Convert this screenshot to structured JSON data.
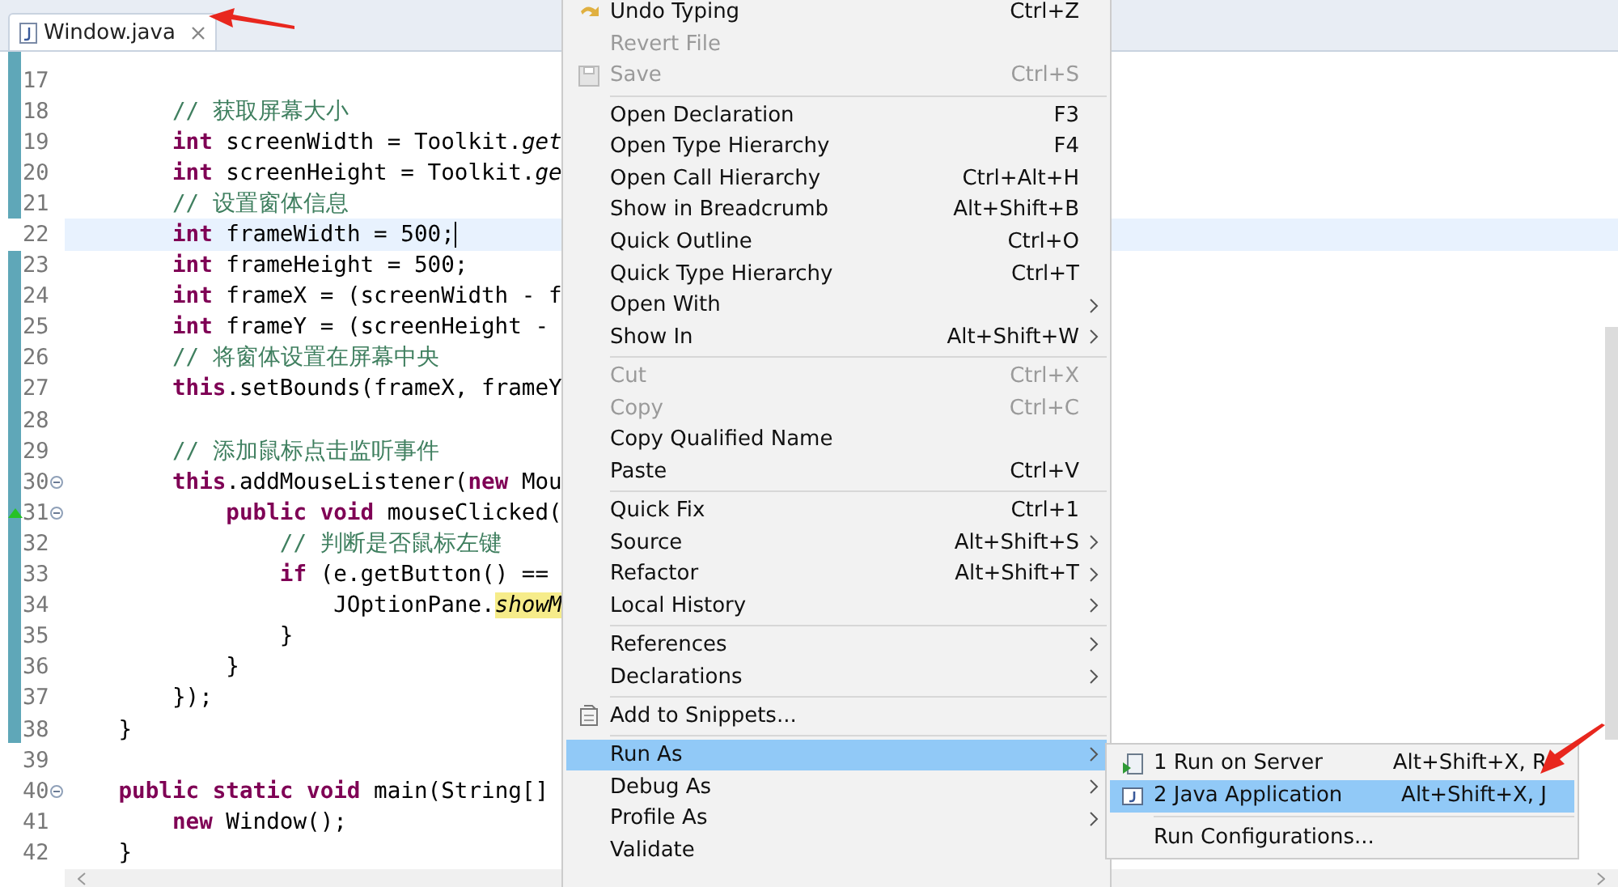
{
  "editor_tab": {
    "title": "Window.java",
    "selected": true
  },
  "code_lines": [
    {
      "number": "17",
      "fold": false,
      "override": false,
      "current": false
    },
    {
      "number": "18",
      "fold": false,
      "override": false,
      "current": false,
      "segments": [
        {
          "kind": "comment",
          "text": "        // 获取屏幕大小"
        }
      ]
    },
    {
      "number": "19",
      "fold": false,
      "override": false,
      "current": false,
      "segments": [
        {
          "kind": "keyword",
          "text": "        int"
        },
        {
          "kind": "plain",
          "text": " screenWidth = Toolkit."
        },
        {
          "kind": "static",
          "text": "get"
        }
      ]
    },
    {
      "number": "20",
      "fold": false,
      "override": false,
      "current": false,
      "segments": [
        {
          "kind": "keyword",
          "text": "        int"
        },
        {
          "kind": "plain",
          "text": " screenHeight = Toolkit."
        },
        {
          "kind": "static",
          "text": "ge"
        }
      ]
    },
    {
      "number": "21",
      "fold": false,
      "override": false,
      "current": false,
      "segments": [
        {
          "kind": "comment",
          "text": "        // 设置窗体信息"
        }
      ]
    },
    {
      "number": "22",
      "fold": false,
      "override": false,
      "current": true,
      "segments": [
        {
          "kind": "keyword",
          "text": "        int"
        },
        {
          "kind": "plain",
          "text": " frameWidth = 500;"
        }
      ]
    },
    {
      "number": "23",
      "fold": false,
      "override": false,
      "current": false,
      "segments": [
        {
          "kind": "keyword",
          "text": "        int"
        },
        {
          "kind": "plain",
          "text": " frameHeight = 500;"
        }
      ]
    },
    {
      "number": "24",
      "fold": false,
      "override": false,
      "current": false,
      "segments": [
        {
          "kind": "keyword",
          "text": "        int"
        },
        {
          "kind": "plain",
          "text": " frameX = (screenWidth - f"
        }
      ]
    },
    {
      "number": "25",
      "fold": false,
      "override": false,
      "current": false,
      "segments": [
        {
          "kind": "keyword",
          "text": "        int"
        },
        {
          "kind": "plain",
          "text": " frameY = (screenHeight -"
        }
      ]
    },
    {
      "number": "26",
      "fold": false,
      "override": false,
      "current": false,
      "segments": [
        {
          "kind": "comment",
          "text": "        // 将窗体设置在屏幕中央"
        }
      ]
    },
    {
      "number": "27",
      "fold": false,
      "override": false,
      "current": false,
      "segments": [
        {
          "kind": "keyword",
          "text": "        this"
        },
        {
          "kind": "plain",
          "text": ".setBounds(frameX, frameY"
        }
      ]
    },
    {
      "number": "28",
      "fold": false,
      "override": false,
      "current": false
    },
    {
      "number": "29",
      "fold": false,
      "override": false,
      "current": false,
      "segments": [
        {
          "kind": "comment",
          "text": "        // 添加鼠标点击监听事件"
        }
      ]
    },
    {
      "number": "30",
      "fold": true,
      "override": false,
      "current": false,
      "segments": [
        {
          "kind": "keyword",
          "text": "        this"
        },
        {
          "kind": "plain",
          "text": ".addMouseListener("
        },
        {
          "kind": "keyword",
          "text": "new"
        },
        {
          "kind": "plain",
          "text": " Mou"
        }
      ]
    },
    {
      "number": "31",
      "fold": true,
      "override": true,
      "current": false,
      "segments": [
        {
          "kind": "keyword",
          "text": "            public void"
        },
        {
          "kind": "plain",
          "text": " mouseClicked("
        }
      ]
    },
    {
      "number": "32",
      "fold": false,
      "override": false,
      "current": false,
      "segments": [
        {
          "kind": "comment",
          "text": "                // 判断是否鼠标左键"
        }
      ]
    },
    {
      "number": "33",
      "fold": false,
      "override": false,
      "current": false,
      "segments": [
        {
          "kind": "keyword",
          "text": "                if"
        },
        {
          "kind": "plain",
          "text": " (e.getButton() =="
        }
      ]
    },
    {
      "number": "34",
      "fold": false,
      "override": false,
      "current": false,
      "segments": [
        {
          "kind": "plain",
          "text": "                    JOptionPane."
        },
        {
          "kind": "occurrence",
          "text": "showM"
        }
      ]
    },
    {
      "number": "35",
      "fold": false,
      "override": false,
      "current": false,
      "segments": [
        {
          "kind": "plain",
          "text": "                }"
        }
      ]
    },
    {
      "number": "36",
      "fold": false,
      "override": false,
      "current": false,
      "segments": [
        {
          "kind": "plain",
          "text": "            }"
        }
      ]
    },
    {
      "number": "37",
      "fold": false,
      "override": false,
      "current": false,
      "segments": [
        {
          "kind": "plain",
          "text": "        });"
        }
      ]
    },
    {
      "number": "38",
      "fold": false,
      "override": false,
      "current": false,
      "segments": [
        {
          "kind": "plain",
          "text": "    }"
        }
      ]
    },
    {
      "number": "39",
      "fold": false,
      "override": false,
      "current": false
    },
    {
      "number": "40",
      "fold": true,
      "override": false,
      "current": false,
      "segments": [
        {
          "kind": "keyword",
          "text": "    public static void"
        },
        {
          "kind": "plain",
          "text": " main(String[]"
        }
      ]
    },
    {
      "number": "41",
      "fold": false,
      "override": false,
      "current": false,
      "segments": [
        {
          "kind": "keyword",
          "text": "        new"
        },
        {
          "kind": "plain",
          "text": " Window();"
        }
      ]
    },
    {
      "number": "42",
      "fold": false,
      "override": false,
      "current": false,
      "segments": [
        {
          "kind": "plain",
          "text": "    }"
        }
      ]
    }
  ],
  "context_menu": {
    "items": [
      {
        "kind": "command",
        "label": "Undo Typing",
        "shortcut": "Ctrl+Z",
        "submenu": false,
        "disabled": false,
        "selected": false
      },
      {
        "kind": "command",
        "label": "Revert File",
        "submenu": false,
        "disabled": true,
        "selected": false
      },
      {
        "kind": "command",
        "label": "Save",
        "shortcut": "Ctrl+S",
        "submenu": false,
        "disabled": true,
        "selected": false
      },
      {
        "kind": "separator"
      },
      {
        "kind": "command",
        "label": "Open Declaration",
        "shortcut": "F3",
        "submenu": false,
        "disabled": false,
        "selected": false
      },
      {
        "kind": "command",
        "label": "Open Type Hierarchy",
        "shortcut": "F4",
        "submenu": false,
        "disabled": false,
        "selected": false
      },
      {
        "kind": "command",
        "label": "Open Call Hierarchy",
        "shortcut": "Ctrl+Alt+H",
        "submenu": false,
        "disabled": false,
        "selected": false
      },
      {
        "kind": "command",
        "label": "Show in Breadcrumb",
        "shortcut": "Alt+Shift+B",
        "submenu": false,
        "disabled": false,
        "selected": false
      },
      {
        "kind": "command",
        "label": "Quick Outline",
        "shortcut": "Ctrl+O",
        "submenu": false,
        "disabled": false,
        "selected": false
      },
      {
        "kind": "command",
        "label": "Quick Type Hierarchy",
        "shortcut": "Ctrl+T",
        "submenu": false,
        "disabled": false,
        "selected": false
      },
      {
        "kind": "command",
        "label": "Open With",
        "submenu": true,
        "disabled": false,
        "selected": false
      },
      {
        "kind": "command",
        "label": "Show In",
        "shortcut": "Alt+Shift+W",
        "submenu": true,
        "disabled": false,
        "selected": false
      },
      {
        "kind": "separator"
      },
      {
        "kind": "command",
        "label": "Cut",
        "shortcut": "Ctrl+X",
        "submenu": false,
        "disabled": true,
        "selected": false
      },
      {
        "kind": "command",
        "label": "Copy",
        "shortcut": "Ctrl+C",
        "submenu": false,
        "disabled": true,
        "selected": false
      },
      {
        "kind": "command",
        "label": "Copy Qualified Name",
        "submenu": false,
        "disabled": false,
        "selected": false
      },
      {
        "kind": "command",
        "label": "Paste",
        "shortcut": "Ctrl+V",
        "submenu": false,
        "disabled": false,
        "selected": false
      },
      {
        "kind": "separator"
      },
      {
        "kind": "command",
        "label": "Quick Fix",
        "shortcut": "Ctrl+1",
        "submenu": false,
        "disabled": false,
        "selected": false
      },
      {
        "kind": "command",
        "label": "Source",
        "shortcut": "Alt+Shift+S",
        "submenu": true,
        "disabled": false,
        "selected": false
      },
      {
        "kind": "command",
        "label": "Refactor",
        "shortcut": "Alt+Shift+T",
        "submenu": true,
        "disabled": false,
        "selected": false
      },
      {
        "kind": "command",
        "label": "Local History",
        "submenu": true,
        "disabled": false,
        "selected": false
      },
      {
        "kind": "separator"
      },
      {
        "kind": "command",
        "label": "References",
        "submenu": true,
        "disabled": false,
        "selected": false
      },
      {
        "kind": "command",
        "label": "Declarations",
        "submenu": true,
        "disabled": false,
        "selected": false
      },
      {
        "kind": "separator"
      },
      {
        "kind": "command",
        "label": "Add to Snippets...",
        "submenu": false,
        "disabled": false,
        "selected": false
      },
      {
        "kind": "separator"
      },
      {
        "kind": "command",
        "label": "Run As",
        "submenu": true,
        "disabled": false,
        "selected": true
      },
      {
        "kind": "command",
        "label": "Debug As",
        "submenu": true,
        "disabled": false,
        "selected": false
      },
      {
        "kind": "command",
        "label": "Profile As",
        "submenu": true,
        "disabled": false,
        "selected": false
      },
      {
        "kind": "command",
        "label": "Validate",
        "submenu": false,
        "disabled": false,
        "selected": false
      }
    ]
  },
  "run_as_submenu": {
    "items": [
      {
        "kind": "command",
        "label": "1 Run on Server",
        "shortcut": "Alt+Shift+X, R",
        "selected": false
      },
      {
        "kind": "command",
        "label": "2 Java Application",
        "shortcut": "Alt+Shift+X, J",
        "selected": true
      },
      {
        "kind": "separator"
      },
      {
        "kind": "command",
        "label": "Run Configurations...",
        "selected": false
      }
    ]
  }
}
